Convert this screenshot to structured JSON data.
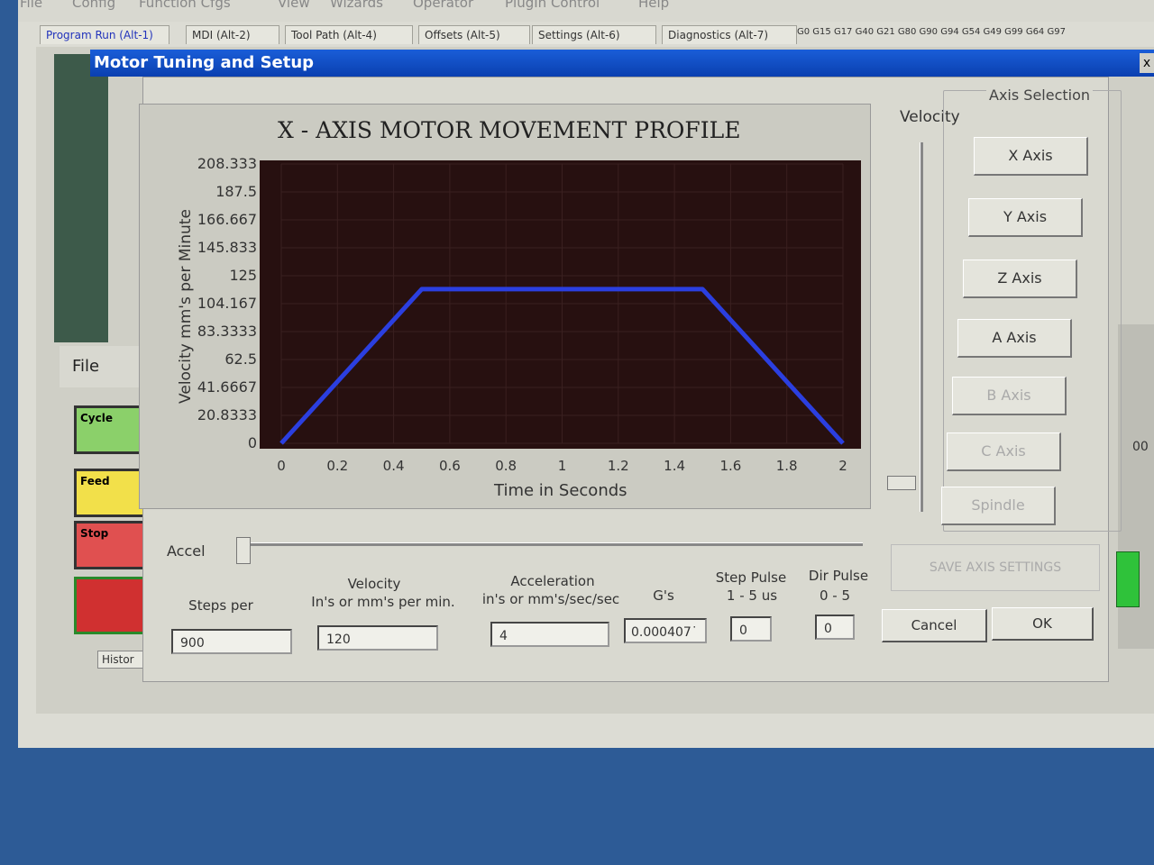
{
  "menu": [
    "File",
    "Config",
    "Function Cfgs",
    "View",
    "Wizards",
    "Operator",
    "PlugIn Control",
    "Help"
  ],
  "tabs": [
    {
      "label": "Program Run (Alt-1)",
      "active": true
    },
    {
      "label": "MDI (Alt-2)",
      "active": false
    },
    {
      "label": "Tool Path (Alt-4)",
      "active": false
    },
    {
      "label": "Offsets (Alt-5)",
      "active": false
    },
    {
      "label": "Settings (Alt-6)",
      "active": false
    },
    {
      "label": "Diagnostics (Alt-7)",
      "active": false
    }
  ],
  "gcode_status": "G0 G15 G17 G40 G21 G80 G90 G94 G54 G49 G99 G64 G97",
  "background": {
    "file_label": "File",
    "cycle_label": "Cycle",
    "feed_label": "Feed",
    "stop_label": "Stop",
    "history_label": "Histor",
    "right_value": "00"
  },
  "dialog": {
    "title": "Motor Tuning and Setup",
    "close_label": "x",
    "velocity_slider_label": "Velocity",
    "axis_selection_label": "Axis Selection",
    "axis_buttons": [
      {
        "label": "X Axis",
        "enabled": true
      },
      {
        "label": "Y Axis",
        "enabled": true
      },
      {
        "label": "Z Axis",
        "enabled": true
      },
      {
        "label": "A Axis",
        "enabled": true
      },
      {
        "label": "B Axis",
        "enabled": false
      },
      {
        "label": "C Axis",
        "enabled": false
      },
      {
        "label": "Spindle",
        "enabled": false
      }
    ],
    "accel_label": "Accel",
    "save_button": "SAVE AXIS SETTINGS",
    "cancel_button": "Cancel",
    "ok_button": "OK",
    "fields": {
      "steps_per": {
        "label": "Steps per",
        "value": "900"
      },
      "velocity": {
        "label1": "Velocity",
        "label2": "In's or mm's per min.",
        "value": "120"
      },
      "acceleration": {
        "label1": "Acceleration",
        "label2": "in's or mm's/sec/sec",
        "value": "4"
      },
      "gs": {
        "label": "G's",
        "value": "0.000407˙"
      },
      "step_pulse": {
        "label1": "Step Pulse",
        "label2": "1 - 5 us",
        "value": "0"
      },
      "dir_pulse": {
        "label1": "Dir Pulse",
        "label2": "0 - 5",
        "value": "0"
      }
    }
  },
  "chart_data": {
    "type": "line",
    "title": "X - AXIS MOTOR MOVEMENT PROFILE",
    "xlabel": "Time in Seconds",
    "ylabel": "Velocity mm's per Minute",
    "xlim": [
      0,
      2
    ],
    "ylim": [
      0,
      208.333
    ],
    "x_ticks": [
      "0",
      "0.2",
      "0.4",
      "0.6",
      "0.8",
      "1",
      "1.2",
      "1.4",
      "1.6",
      "1.8",
      "2"
    ],
    "y_ticks": [
      "208.333",
      "187.5",
      "166.667",
      "145.833",
      "125",
      "104.167",
      "83.3333",
      "62.5",
      "41.6667",
      "20.8333",
      "0"
    ],
    "series": [
      {
        "x": [
          0,
          0.5,
          1.5,
          2
        ],
        "y": [
          0,
          115,
          115,
          0
        ],
        "color": "#2b3fe0"
      }
    ],
    "plot_bg": "#271010",
    "grid": true
  }
}
